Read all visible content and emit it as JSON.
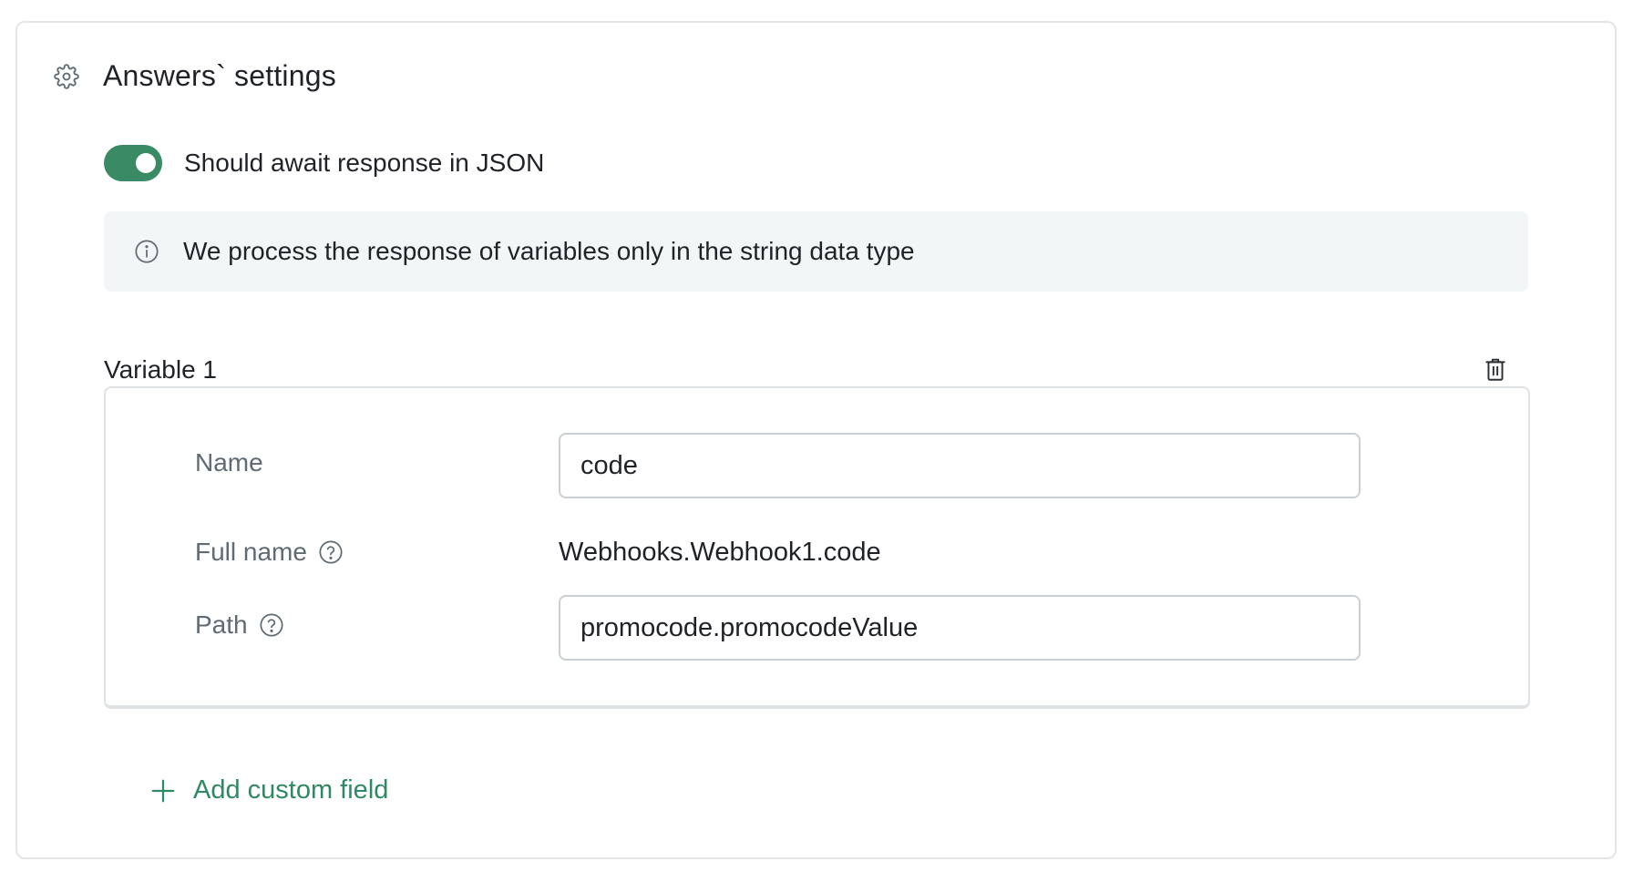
{
  "section": {
    "title": "Answers` settings",
    "icon": "gear-icon"
  },
  "toggle": {
    "label": "Should await response in JSON",
    "checked": true,
    "color": "#3a8a66"
  },
  "info": {
    "icon": "info-icon",
    "text": "We process the response of variables only in the string data type"
  },
  "variable": {
    "title": "Variable 1",
    "fields": {
      "name_label": "Name",
      "name_value": "code",
      "full_name_label": "Full name",
      "full_name_value": "Webhooks.Webhook1.code",
      "path_label": "Path",
      "path_value": "promocode.promocodeValue"
    }
  },
  "actions": {
    "add_custom_field": "Add custom field",
    "accent_color": "#2f8a63"
  }
}
